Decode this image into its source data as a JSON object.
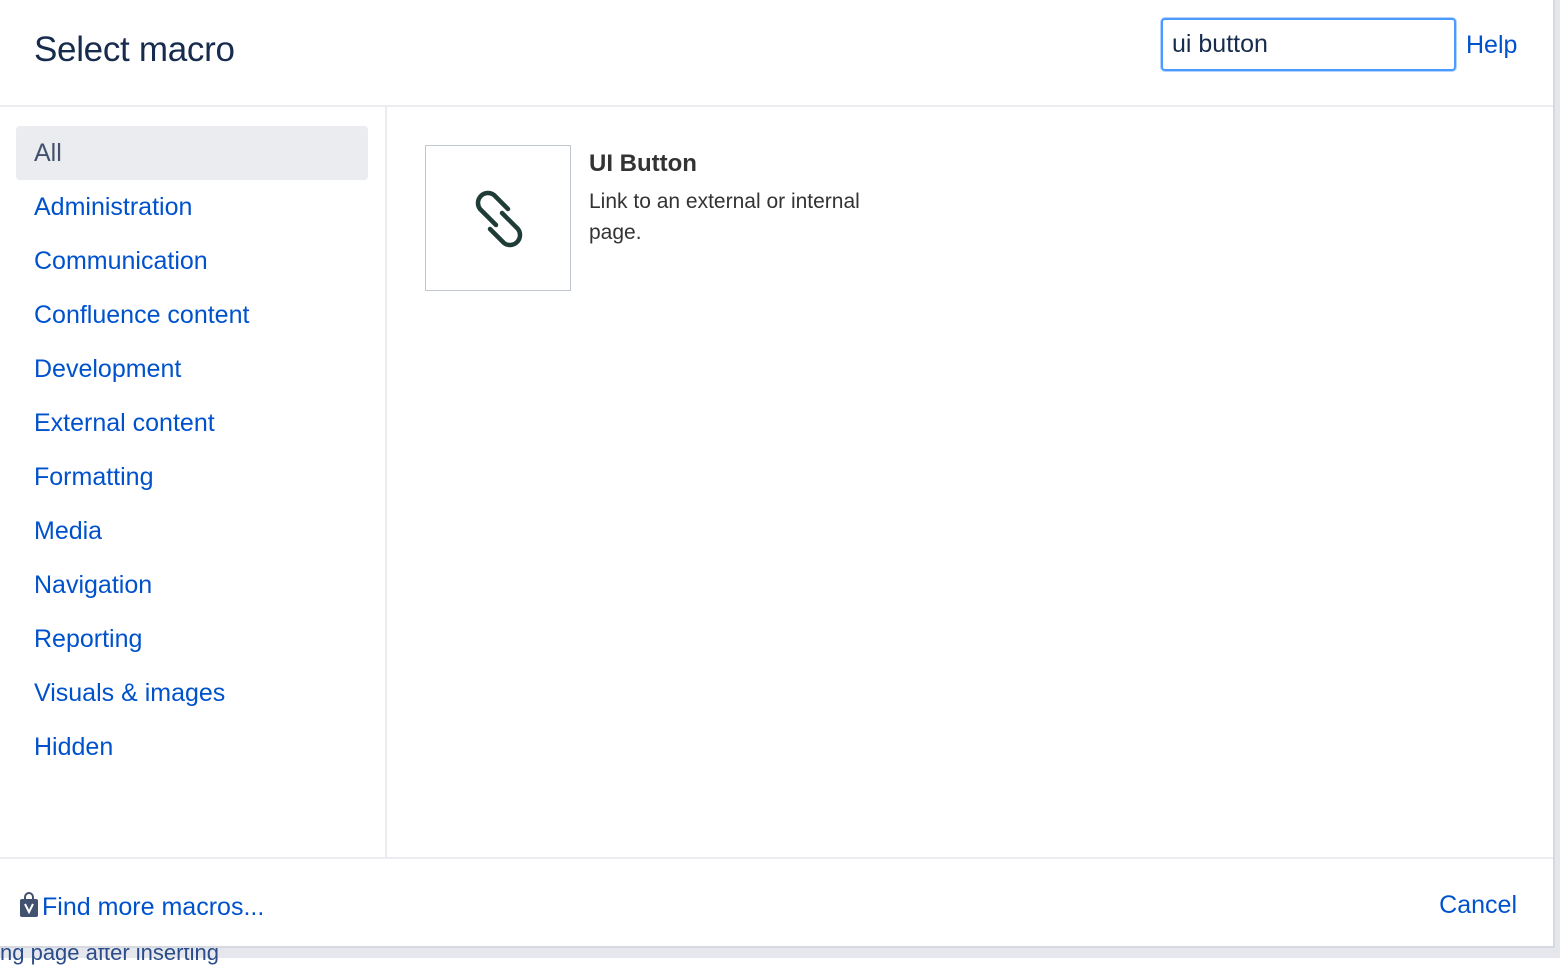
{
  "behind": {
    "fragment_text": "ng page after inserting"
  },
  "dialog": {
    "title": "Select macro",
    "search": {
      "value": "ui button",
      "placeholder": ""
    },
    "help_label": "Help"
  },
  "sidebar": {
    "items": [
      {
        "label": "All",
        "active": true
      },
      {
        "label": "Administration",
        "active": false
      },
      {
        "label": "Communication",
        "active": false
      },
      {
        "label": "Confluence content",
        "active": false
      },
      {
        "label": "Development",
        "active": false
      },
      {
        "label": "External content",
        "active": false
      },
      {
        "label": "Formatting",
        "active": false
      },
      {
        "label": "Media",
        "active": false
      },
      {
        "label": "Navigation",
        "active": false
      },
      {
        "label": "Reporting",
        "active": false
      },
      {
        "label": "Visuals & images",
        "active": false
      },
      {
        "label": "Hidden",
        "active": false
      }
    ]
  },
  "results": {
    "items": [
      {
        "name": "UI Button",
        "description": "Link to an external or internal page.",
        "icon": "link-icon"
      }
    ]
  },
  "footer": {
    "find_more_label": "Find more macros...",
    "find_more_icon": "marketplace-bag-icon",
    "cancel_label": "Cancel"
  },
  "colors": {
    "link": "#0052cc",
    "title": "#172b4d",
    "active_bg": "#ebecf0",
    "focus_border": "#4c9aff",
    "icon_stroke": "#1f3d36"
  }
}
